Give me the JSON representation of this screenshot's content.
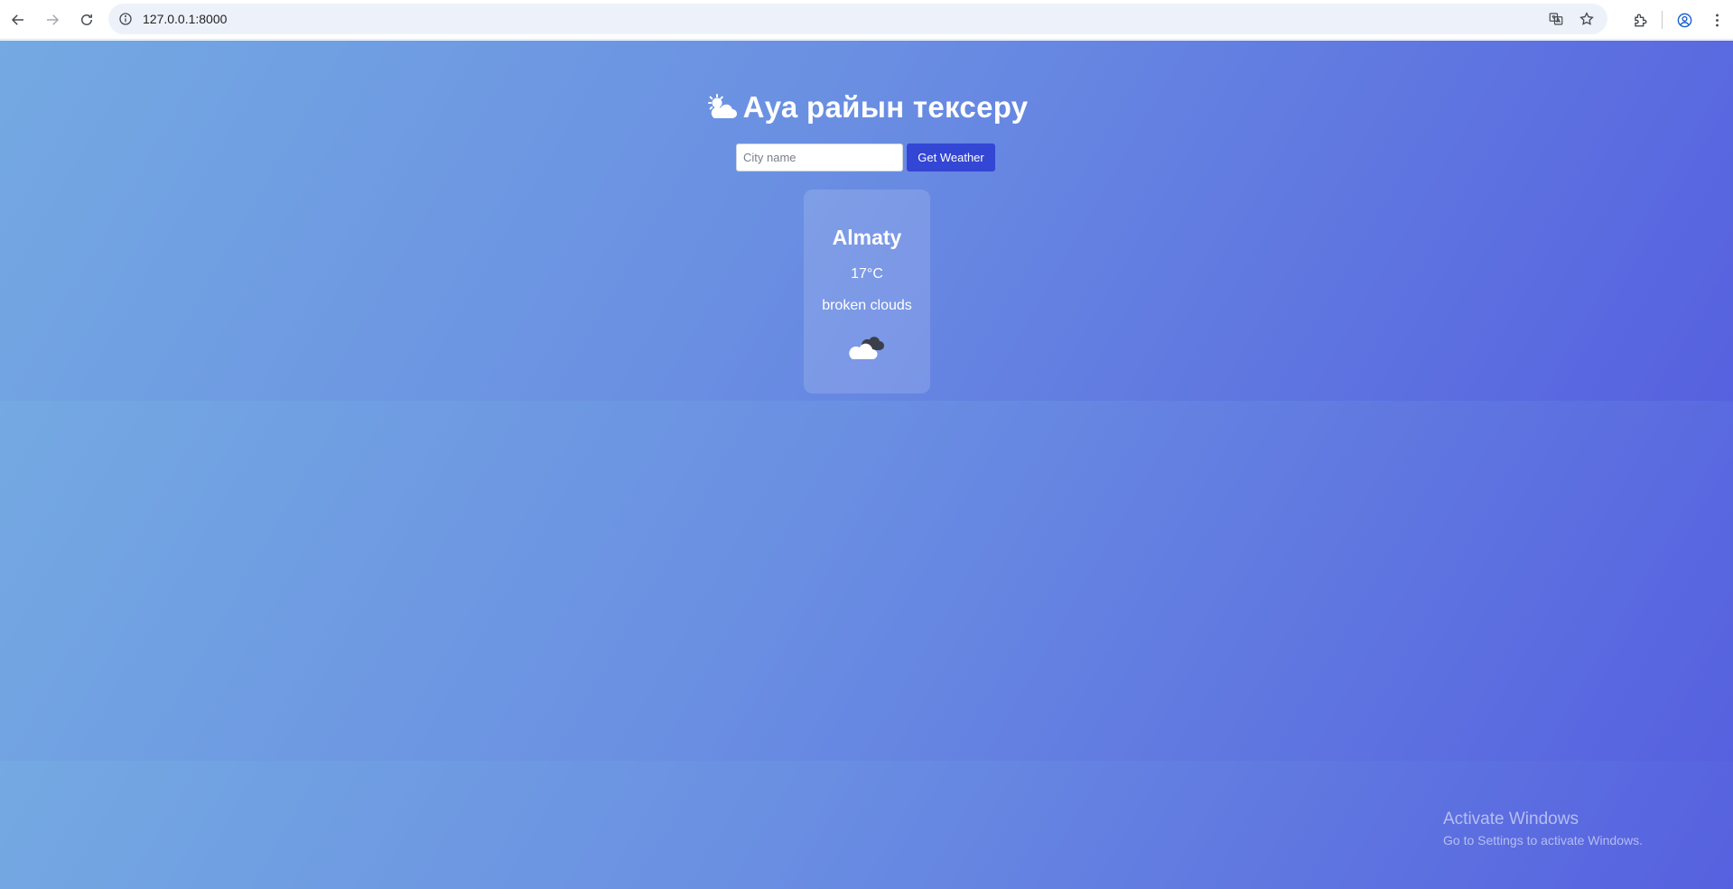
{
  "browser": {
    "url": "127.0.0.1:8000"
  },
  "app": {
    "title": "Ауа райын тексеру",
    "title_icon": "sun-behind-cloud-icon",
    "search": {
      "placeholder": "City name",
      "value": "",
      "button_label": "Get Weather"
    },
    "result": {
      "city": "Almaty",
      "temperature": "17°C",
      "description": "broken clouds",
      "icon": "broken-clouds-icon"
    }
  },
  "os_watermark": {
    "line1": "Activate Windows",
    "line2": "Go to Settings to activate Windows."
  },
  "colors": {
    "gradient_start": "#74a9e2",
    "gradient_end": "#5661df",
    "button": "#3346d4"
  }
}
